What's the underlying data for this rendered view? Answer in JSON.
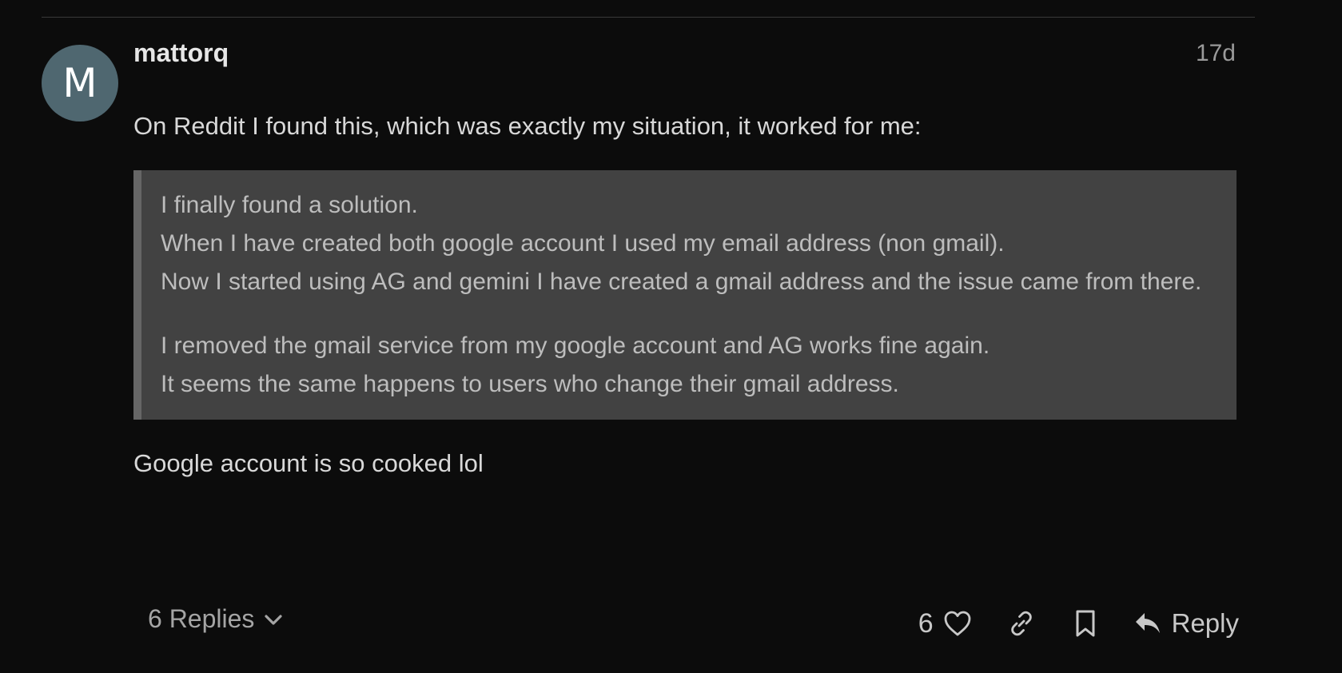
{
  "post": {
    "avatar_letter": "M",
    "username": "mattorq",
    "date": "17d",
    "intro": "On Reddit I found this, which was exactly my situation, it worked for me:",
    "quote": {
      "paragraph1": [
        "I finally found a solution.",
        "When I have created both google account I used my email address (non gmail).",
        "Now I started using AG and gemini I have created a gmail address and the issue came from there."
      ],
      "paragraph2": [
        "I removed the gmail service from my google account and AG works fine again.",
        "It seems the same happens to users who change their gmail address."
      ]
    },
    "closing": "Google account is so cooked lol"
  },
  "actions": {
    "replies_label": "6 Replies",
    "like_count": "6",
    "reply_label": "Reply"
  },
  "colors": {
    "background": "#0c0c0c",
    "avatar": "#4f6770",
    "quote_background": "#424242",
    "quote_border": "#666666"
  },
  "icons": {
    "replies_toggle": "chevron-down-icon",
    "like": "heart-icon",
    "share": "link-icon",
    "bookmark": "bookmark-icon",
    "reply": "reply-arrow-icon"
  }
}
